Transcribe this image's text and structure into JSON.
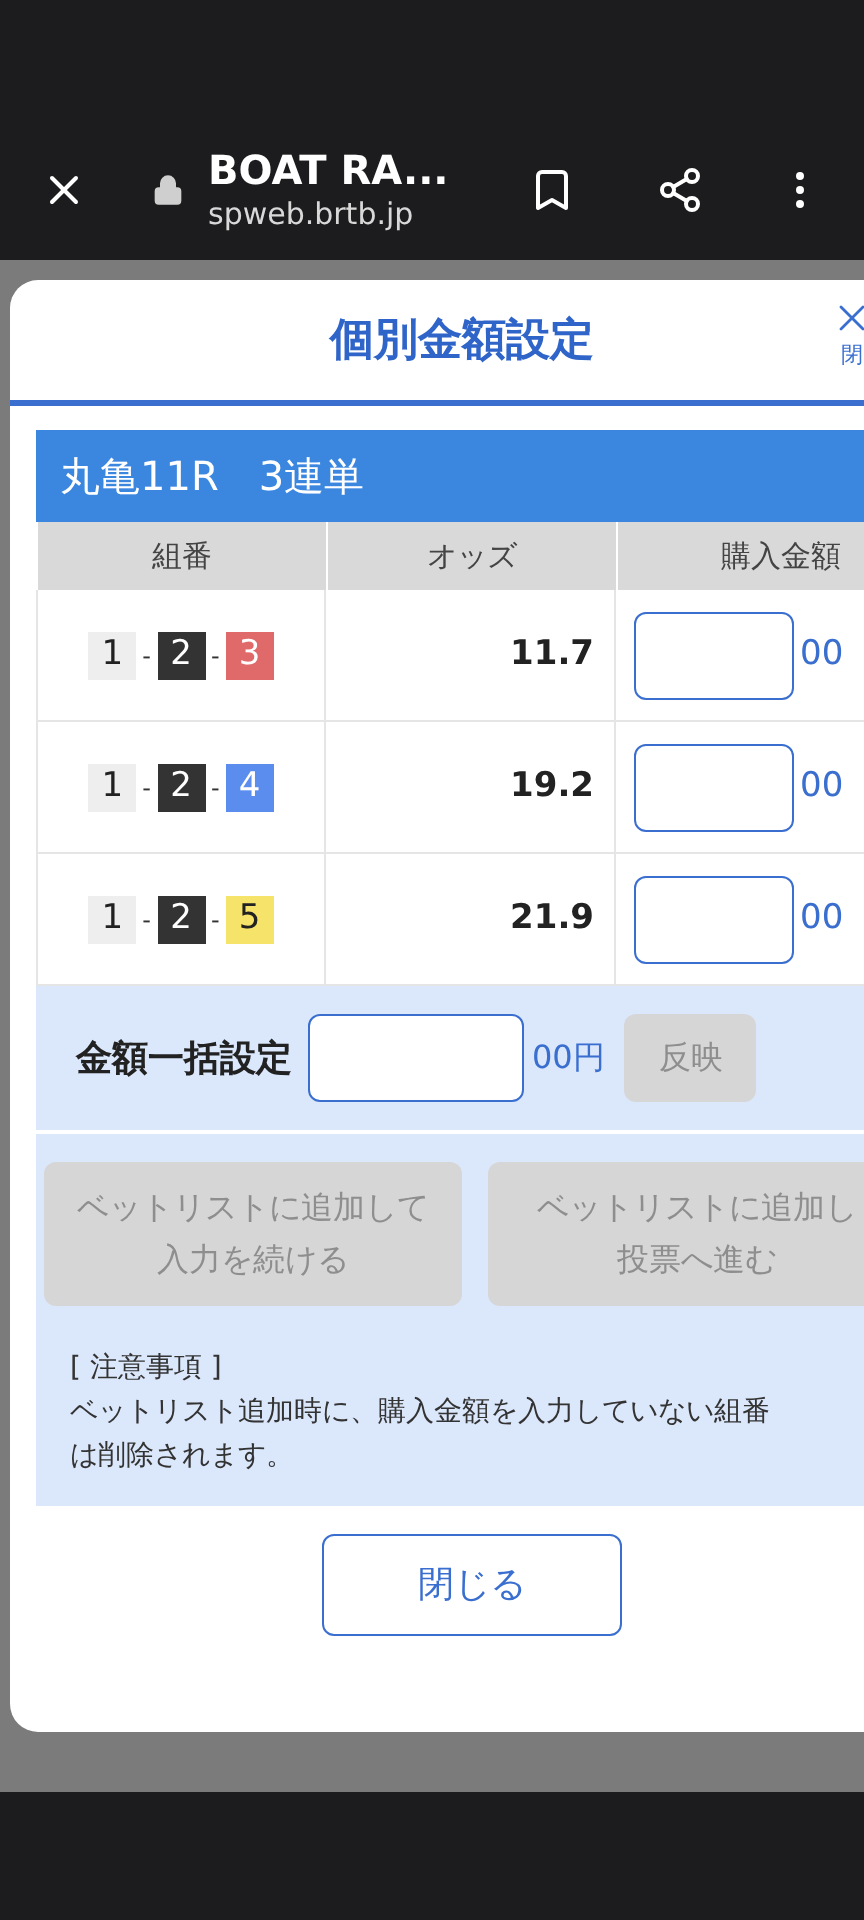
{
  "browser": {
    "title": "BOAT RA...",
    "url": "spweb.brtb.jp"
  },
  "modal": {
    "title": "個別金額設定",
    "close_label": "閉",
    "section_title": "丸亀11R　3連単",
    "columns": [
      "組番",
      "オッズ",
      "購入金額"
    ],
    "rows": [
      {
        "combo": [
          {
            "number": "1",
            "color": "#eeeeee"
          },
          {
            "number": "2",
            "color": "#333333"
          },
          {
            "number": "3",
            "color": "#e06a6a"
          }
        ],
        "separator": "-",
        "odds": "11.7",
        "unit": "00"
      },
      {
        "combo": [
          {
            "number": "1",
            "color": "#eeeeee"
          },
          {
            "number": "2",
            "color": "#333333"
          },
          {
            "number": "4",
            "color": "#5b8def"
          }
        ],
        "separator": "-",
        "odds": "19.2",
        "unit": "00"
      },
      {
        "combo": [
          {
            "number": "1",
            "color": "#eeeeee"
          },
          {
            "number": "2",
            "color": "#333333"
          },
          {
            "number": "5",
            "color": "#f5e36a"
          }
        ],
        "separator": "-",
        "odds": "21.9",
        "unit": "00"
      }
    ],
    "bulk": {
      "label": "金額一括設定",
      "unit": "00円",
      "apply": "反映",
      "apply_disabled": true
    },
    "actions": [
      {
        "lines": [
          "ベットリストに追加して",
          "入力を続ける"
        ],
        "disabled": true
      },
      {
        "lines": [
          "ベットリストに追加し",
          "投票へ進む"
        ],
        "disabled": true
      }
    ],
    "notes_title": "[ 注意事項 ]",
    "notes_lines": [
      "ベットリスト追加時に、購入金額を入力していない組番",
      "は削除されます。"
    ],
    "close_button": "閉じる"
  }
}
